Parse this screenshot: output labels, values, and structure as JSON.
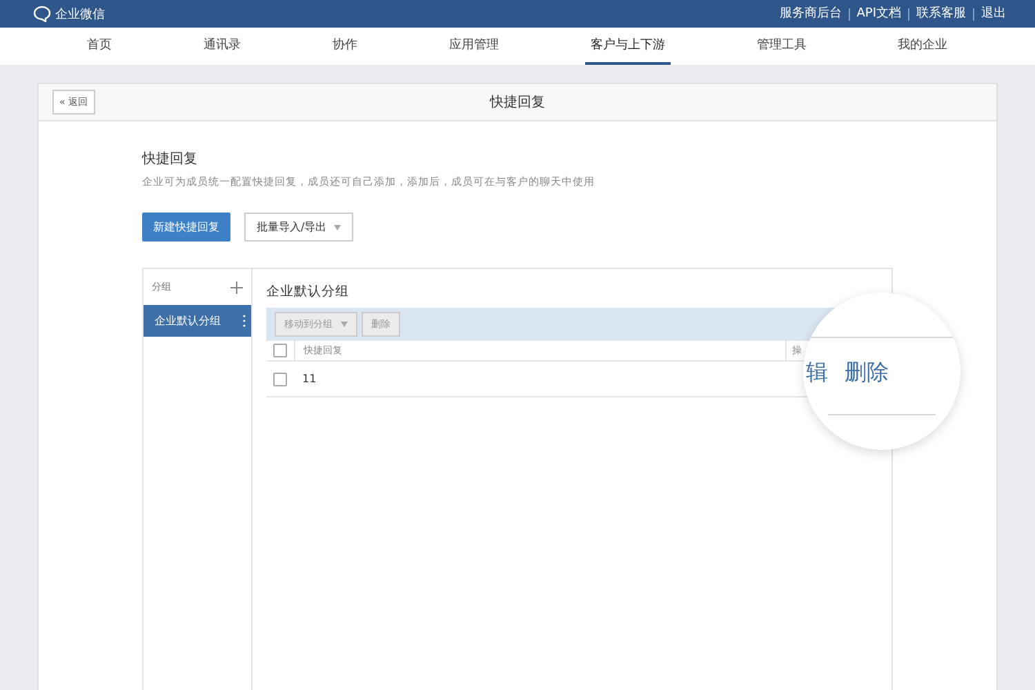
{
  "topbar": {
    "brand": "企业微信",
    "links": [
      "服务商后台",
      "API文档",
      "联系客服",
      "退出"
    ]
  },
  "nav": [
    {
      "label": "首页",
      "selected": false
    },
    {
      "label": "通讯录",
      "selected": false
    },
    {
      "label": "协作",
      "selected": false
    },
    {
      "label": "应用管理",
      "selected": false
    },
    {
      "label": "客户与上下游",
      "selected": true
    },
    {
      "label": "管理工具",
      "selected": false
    },
    {
      "label": "我的企业",
      "selected": false
    }
  ],
  "card": {
    "back": "« 返回",
    "title": "快捷回复"
  },
  "section": {
    "title": "快捷回复",
    "description": "企业可为成员统一配置快捷回复，成员还可自己添加，添加后，成员可在与客户的聊天中使用",
    "new_button": "新建快捷回复",
    "import_button": "批量导入/导出"
  },
  "groups": {
    "header": "分组",
    "items": [
      {
        "label": "企业默认分组",
        "selected": true
      }
    ]
  },
  "table": {
    "title": "企业默认分组",
    "move_button": "移动到分组",
    "delete_button": "删除",
    "columns": [
      "快捷回复",
      "操"
    ],
    "select_all_checked": false,
    "rows": [
      {
        "cells": [
          "11"
        ],
        "checked": false
      }
    ]
  },
  "magnifier": {
    "texts": [
      "辑",
      "删除"
    ]
  }
}
